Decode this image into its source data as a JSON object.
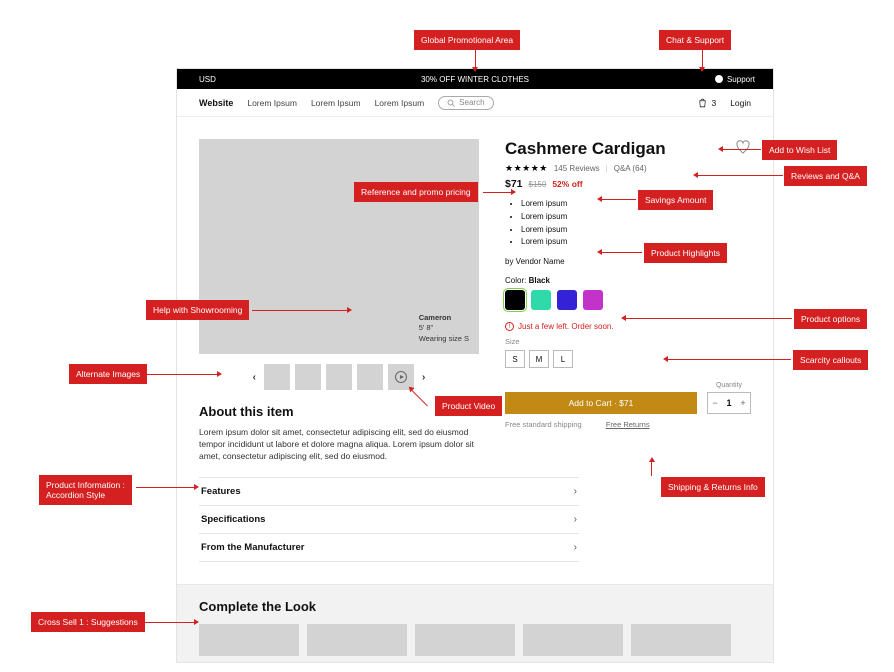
{
  "annotations": {
    "global_promo": "Global Promotional Area",
    "chat_support": "Chat & Support",
    "ref_promo_pricing": "Reference and promo pricing",
    "add_wishlist": "Add to Wish List",
    "reviews_qa": "Reviews and Q&A",
    "savings_amount": "Savings Amount",
    "product_highlights": "Product Highlights",
    "showrooming": "Help with Showrooming",
    "product_options": "Product options",
    "alternate_images": "Alternate Images",
    "product_video": "Product Video",
    "scarcity": "Scarcity callouts",
    "accordion": "Product Information :\nAccordion Style",
    "shipreturns": "Shipping & Returns Info",
    "cross_sell": "Cross Sell 1 : Suggestions"
  },
  "promobar": {
    "currency": "USD",
    "promo_text": "30% OFF WINTER CLOTHES",
    "support": "Support"
  },
  "navbar": {
    "brand": "Website",
    "links": [
      "Lorem Ipsum",
      "Lorem Ipsum",
      "Lorem Ipsum"
    ],
    "search_placeholder": "Search",
    "cart_count": "3",
    "login": "Login"
  },
  "product": {
    "title": "Cashmere Cardigan",
    "reviews_count": "145 Reviews",
    "qa_count": "Q&A (64)",
    "price": "$71",
    "orig_price": "$150",
    "pct_off": "52% off",
    "highlights": [
      "Lorem ipsum",
      "Lorem ipsum",
      "Lorem ipsum",
      "Lorem ipsum"
    ],
    "vendor": "by Vendor Name",
    "color_label": "Color: ",
    "color_value": "Black",
    "swatches": [
      "#000000",
      "#2fd9a9",
      "#3423d6",
      "#c233c9"
    ],
    "scarcity": "Just a few left. Order soon.",
    "size_label": "Size",
    "sizes": [
      "S",
      "M",
      "L"
    ],
    "qty_label": "Quantity",
    "qty_value": "1",
    "add_cart": "Add to Cart · $71",
    "ship_free": "Free standard shipping",
    "free_returns": "Free Returns"
  },
  "model": {
    "name": "Cameron",
    "height": "5' 8\"",
    "wearing": "Wearing size S"
  },
  "about": {
    "heading": "About this item",
    "body": "Lorem ipsum dolor sit amet, consectetur adipiscing elit, sed do eiusmod tempor incididunt ut labore et dolore magna aliqua. Lorem ipsum dolor sit amet, consectetur adipiscing elit, sed do eiusmod.",
    "rows": [
      "Features",
      "Specifications",
      "From the Manufacturer"
    ]
  },
  "ctl": {
    "heading": "Complete the Look"
  }
}
